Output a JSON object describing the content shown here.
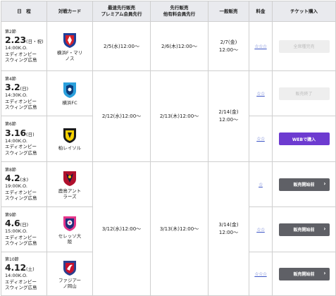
{
  "header": {
    "date": "日　程",
    "match": "対戦カード",
    "presale1_line1": "最速先行販売",
    "presale1_line2": "プレミアム会員先行",
    "presale2_line1": "先行販売",
    "presale2_line2": "他有料会員先行",
    "general": "一般販売",
    "price": "料金",
    "purchase": "チケット購入"
  },
  "rows": [
    {
      "section": "第2節",
      "md": "2.23",
      "dow": "(日・祝)",
      "kickoff": "14:00K.O.",
      "venue_line1": "エディオンピー",
      "venue_line2": "スウィング広島",
      "team_line1": "横浜F・マリ",
      "team_line2": "ノス",
      "crest": "yokohama-fm-crest-icon",
      "stars": "☆☆☆",
      "button": "全席種完売",
      "button_kind": "disabled"
    },
    {
      "section": "第4節",
      "md": "3.2",
      "dow": "(日)",
      "kickoff": "14:30K.O.",
      "venue_line1": "エディオンピー",
      "venue_line2": "スウィング広島",
      "team_line1": "横浜FC",
      "team_line2": "",
      "crest": "yokohama-fc-crest-icon",
      "stars": "☆☆",
      "button": "販売終了",
      "button_kind": "disabled"
    },
    {
      "section": "第6節",
      "md": "3.16",
      "dow": "(日)",
      "kickoff": "14:00K.O.",
      "venue_line1": "エディオンピー",
      "venue_line2": "スウィング広島",
      "team_line1": "柏レイソル",
      "team_line2": "",
      "crest": "kashiwa-crest-icon",
      "stars": "☆☆",
      "button": "WEBで購入",
      "button_kind": "buy"
    },
    {
      "section": "第8節",
      "md": "4.2",
      "dow": "(水)",
      "kickoff": "19:00K.O.",
      "venue_line1": "エディオンピー",
      "venue_line2": "スウィング広島",
      "team_line1": "鹿島アント",
      "team_line2": "ラーズ",
      "crest": "kashima-crest-icon",
      "stars": "☆",
      "button": "販売開始前",
      "button_kind": "soon"
    },
    {
      "section": "第9節",
      "md": "4.6",
      "dow": "(日)",
      "kickoff": "15:00K.O.",
      "venue_line1": "エディオンピー",
      "venue_line2": "スウィング広島",
      "team_line1": "セレッソ大",
      "team_line2": "阪",
      "crest": "cerezo-crest-icon",
      "stars": "☆☆",
      "button": "販売開始前",
      "button_kind": "soon"
    },
    {
      "section": "第10節",
      "md": "4.12",
      "dow": "(土)",
      "kickoff": "14:00K.O.",
      "venue_line1": "エディオンピー",
      "venue_line2": "スウィング広島",
      "team_line1": "ファジアー",
      "team_line2": "ノ岡山",
      "crest": "fagiano-crest-icon",
      "stars": "☆☆☆",
      "button": "販売開始前",
      "button_kind": "soon"
    }
  ],
  "sales": {
    "g1": {
      "presale1": "2/5(水)12:00〜",
      "presale2": "2/6(木)12:00〜",
      "general_line1": "2/7(金)",
      "general_line2": "12:00〜"
    },
    "g2": {
      "presale1": "2/12(水)12:00〜",
      "presale2": "2/13(木)12:00〜",
      "general_line1": "2/14(金)",
      "general_line2": "12:00〜"
    },
    "g3": {
      "presale1": "3/12(水)12:00〜",
      "presale2": "3/13(木)12:00〜",
      "general_line1": "3/14(金)",
      "general_line2": "12:00〜"
    }
  },
  "colors": {
    "link": "#3a53c5",
    "buy": "#6d3bd0",
    "soon": "#5f6066",
    "disabled": "#eeeeee",
    "header_bg": "#e9eaee"
  }
}
